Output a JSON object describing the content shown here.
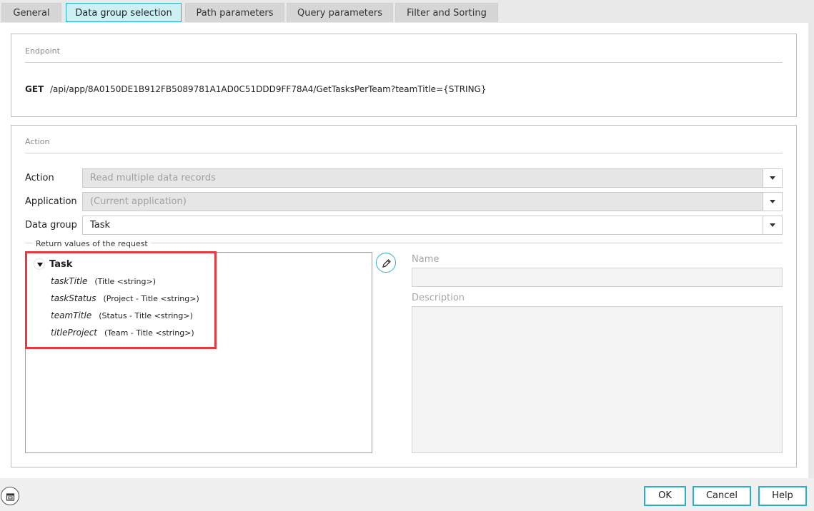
{
  "tabs": [
    {
      "label": "General",
      "active": false
    },
    {
      "label": "Data group selection",
      "active": true
    },
    {
      "label": "Path parameters",
      "active": false
    },
    {
      "label": "Query parameters",
      "active": false
    },
    {
      "label": "Filter and Sorting",
      "active": false
    }
  ],
  "endpoint": {
    "title": "Endpoint",
    "method": "GET",
    "path": "/api/app/8A0150DE1B912FB5089781A1AD0C51DDD9FF78A4/GetTasksPerTeam?teamTitle={STRING}"
  },
  "action": {
    "title": "Action",
    "fields": {
      "action": {
        "label": "Action",
        "value": "Read multiple data records"
      },
      "application": {
        "label": "Application",
        "value": "(Current application)"
      },
      "data_group": {
        "label": "Data group",
        "value": "Task"
      }
    },
    "return_values": {
      "legend": "Return values of the request",
      "root": "Task",
      "items": [
        {
          "name": "taskTitle",
          "type": "(Title <string>)"
        },
        {
          "name": "taskStatus",
          "type": "(Project - Title <string>)"
        },
        {
          "name": "teamTitle",
          "type": "(Status - Title <string>)"
        },
        {
          "name": "titleProject",
          "type": "(Team - Title <string>)"
        }
      ]
    },
    "name_label": "Name",
    "description_label": "Description"
  },
  "footer": {
    "ok": "OK",
    "cancel": "Cancel",
    "help": "Help"
  },
  "colors": {
    "accent": "#2ab0c5",
    "highlight": "#e5393f"
  }
}
